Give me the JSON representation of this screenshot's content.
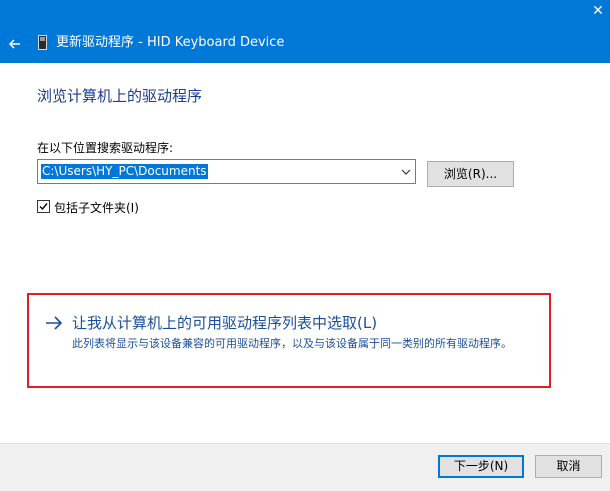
{
  "window": {
    "title": "更新驱动程序 - HID Keyboard Device",
    "back_icon": "back-arrow-icon",
    "close_icon": "close-icon"
  },
  "main": {
    "heading": "浏览计算机上的驱动程序",
    "search_label": "在以下位置搜索驱动程序:",
    "path_value": "C:\\Users\\HY_PC\\Documents",
    "browse_label": "浏览(R)...",
    "include_subfolders_label": "包括子文件夹(I)",
    "include_subfolders_checked": true,
    "option": {
      "title": "让我从计算机上的可用驱动程序列表中选取(L)",
      "description": "此列表将显示与该设备兼容的可用驱动程序，以及与该设备属于同一类别的所有驱动程序。"
    }
  },
  "footer": {
    "next_label": "下一步(N)",
    "cancel_label": "取消"
  },
  "colors": {
    "titlebar": "#0078d7",
    "link_text": "#1a4f9a",
    "highlight_box": "#e02020"
  }
}
